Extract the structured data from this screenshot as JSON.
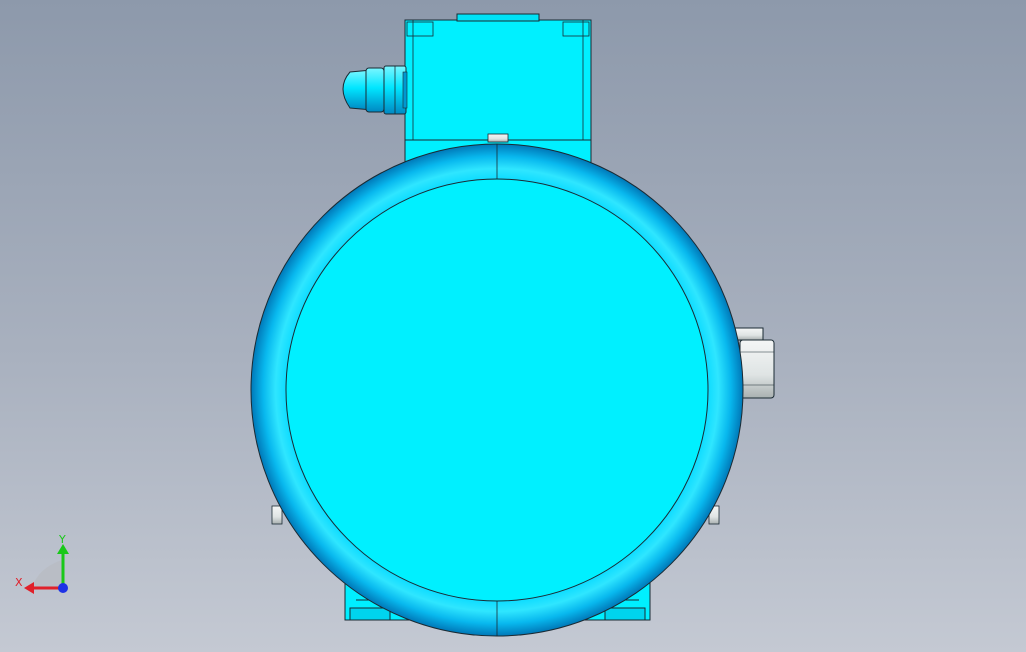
{
  "colors": {
    "background_top": "#8d99ab",
    "background_bottom": "#c4c9d3",
    "motor_body": "#00f0ff",
    "motor_shade": "#0089c8",
    "edge": "#1a2a33",
    "metal": "#e8eef0",
    "axis_x": "#e0202a",
    "axis_y": "#19c819",
    "axis_z": "#1e32e6"
  },
  "icons": {
    "triad": "coordinate-triad-icon"
  },
  "triad": {
    "x_label": "X",
    "y_label": "Y"
  }
}
